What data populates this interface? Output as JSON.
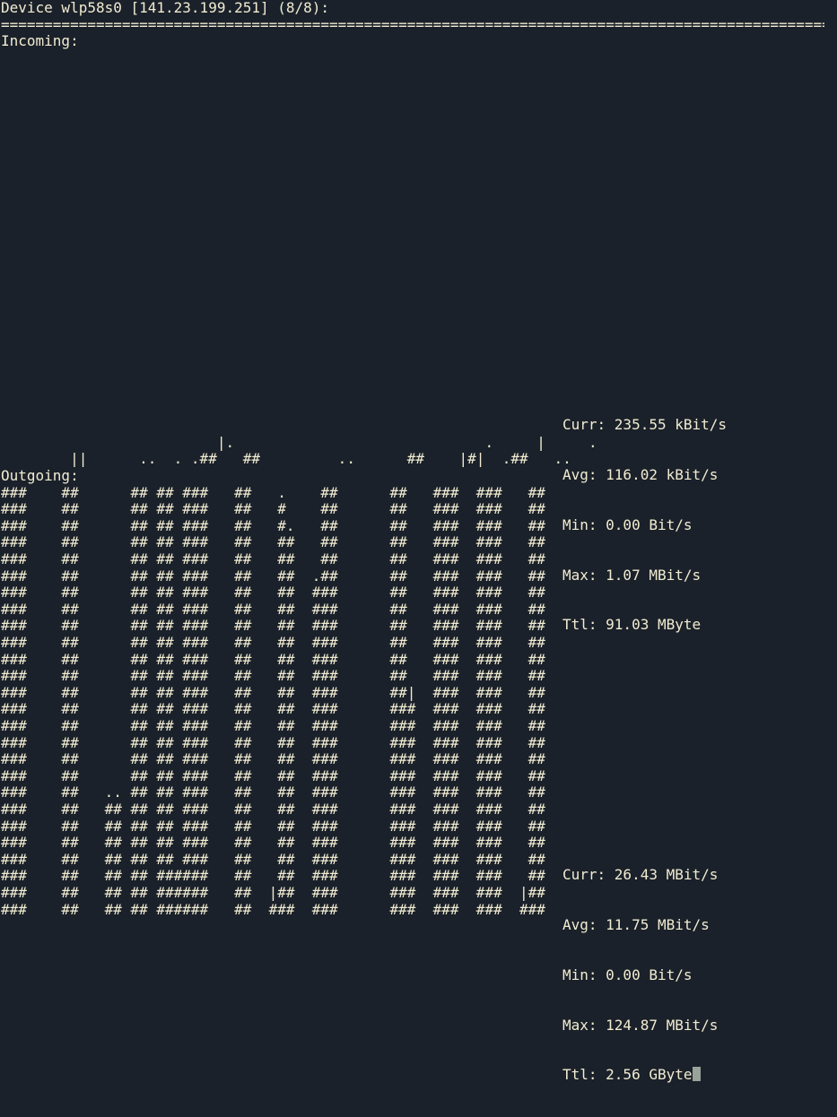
{
  "terminal": {
    "header": "Device wlp58s0 [141.23.199.251] (8/8):",
    "separator": "=============================================================================================================",
    "incoming_label": "Incoming:",
    "outgoing_label": "Outgoing:",
    "incoming_graph": [
      "                         |.                             .     |     .",
      "        ||      ..  . .##   ##         ..      ##    |#|  .##   .."
    ],
    "incoming_stats": {
      "curr": "Curr: 235.55 kBit/s",
      "avg": "Avg: 116.02 kBit/s",
      "min": "Min: 0.00 Bit/s",
      "max": "Max: 1.07 MBit/s",
      "ttl": "Ttl: 91.03 MByte"
    },
    "outgoing_graph": [
      "###    ##      ## ## ###   ##   .    ##      ##   ###  ###   ##",
      "###    ##      ## ## ###   ##   #    ##      ##   ###  ###   ##",
      "###    ##      ## ## ###   ##   #.   ##      ##   ###  ###   ##",
      "###    ##      ## ## ###   ##   ##   ##      ##   ###  ###   ##",
      "###    ##      ## ## ###   ##   ##   ##      ##   ###  ###   ##",
      "###    ##      ## ## ###   ##   ##  .##      ##   ###  ###   ##",
      "###    ##      ## ## ###   ##   ##  ###      ##   ###  ###   ##",
      "###    ##      ## ## ###   ##   ##  ###      ##   ###  ###   ##",
      "###    ##      ## ## ###   ##   ##  ###      ##   ###  ###   ##",
      "###    ##      ## ## ###   ##   ##  ###      ##   ###  ###   ##",
      "###    ##      ## ## ###   ##   ##  ###      ##   ###  ###   ##",
      "###    ##      ## ## ###   ##   ##  ###      ##   ###  ###   ##",
      "###    ##      ## ## ###   ##   ##  ###      ##|  ###  ###   ##",
      "###    ##      ## ## ###   ##   ##  ###      ###  ###  ###   ##",
      "###    ##      ## ## ###   ##   ##  ###      ###  ###  ###   ##",
      "###    ##      ## ## ###   ##   ##  ###      ###  ###  ###   ##",
      "###    ##      ## ## ###   ##   ##  ###      ###  ###  ###   ##",
      "###    ##      ## ## ###   ##   ##  ###      ###  ###  ###   ##",
      "###    ##   .. ## ## ###   ##   ##  ###      ###  ###  ###   ##",
      "###    ##   ## ## ## ###   ##   ##  ###      ###  ###  ###   ##",
      "###    ##   ## ## ## ###   ##   ##  ###      ###  ###  ###   ##",
      "###    ##   ## ## ## ###   ##   ##  ###      ###  ###  ###   ##",
      "###    ##   ## ## ## ###   ##   ##  ###      ###  ###  ###   ##",
      "###    ##   ## ## ######   ##   ##  ###      ###  ###  ###   ##",
      "###    ##   ## ## ######   ##  |##  ###      ###  ###  ###  |##",
      "###    ##   ## ## ######   ##  ###  ###      ###  ###  ###  ###"
    ],
    "outgoing_stats": {
      "curr": "Curr: 26.43 MBit/s",
      "avg": "Avg: 11.75 MBit/s",
      "min": "Min: 0.00 Bit/s",
      "max": "Max: 124.87 MBit/s",
      "ttl": "Ttl: 2.56 GByte"
    },
    "colors": {
      "background": "#1b212a",
      "foreground": "#f1ecd2",
      "cursor": "#9aa39a"
    }
  }
}
